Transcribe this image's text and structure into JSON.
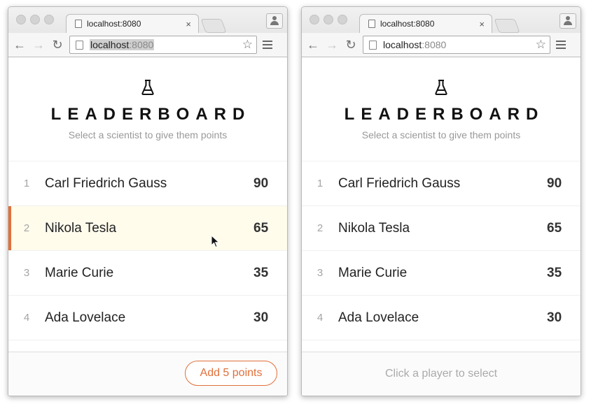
{
  "accent_color": "#e0703b",
  "browsers": [
    {
      "tab_title": "localhost:8080",
      "tab_close": "×",
      "url_host": "localhost",
      "url_port": ":8080",
      "url_selected": true,
      "app": {
        "icon": "flask-icon",
        "title": "LEADERBOARD",
        "subtitle": "Select a scientist to give them points",
        "players": [
          {
            "rank": "1",
            "name": "Carl Friedrich Gauss",
            "score": "90",
            "selected": false
          },
          {
            "rank": "2",
            "name": "Nikola Tesla",
            "score": "65",
            "selected": true
          },
          {
            "rank": "3",
            "name": "Marie Curie",
            "score": "35",
            "selected": false
          },
          {
            "rank": "4",
            "name": "Ada Lovelace",
            "score": "30",
            "selected": false
          }
        ],
        "footer": {
          "button_label": "Add 5 points"
        }
      }
    },
    {
      "tab_title": "localhost:8080",
      "tab_close": "×",
      "url_host": "localhost",
      "url_port": ":8080",
      "url_selected": false,
      "app": {
        "icon": "flask-icon",
        "title": "LEADERBOARD",
        "subtitle": "Select a scientist to give them points",
        "players": [
          {
            "rank": "1",
            "name": "Carl Friedrich Gauss",
            "score": "90",
            "selected": false
          },
          {
            "rank": "2",
            "name": "Nikola Tesla",
            "score": "65",
            "selected": false
          },
          {
            "rank": "3",
            "name": "Marie Curie",
            "score": "35",
            "selected": false
          },
          {
            "rank": "4",
            "name": "Ada Lovelace",
            "score": "30",
            "selected": false
          }
        ],
        "footer": {
          "hint": "Click a player to select"
        }
      }
    }
  ]
}
